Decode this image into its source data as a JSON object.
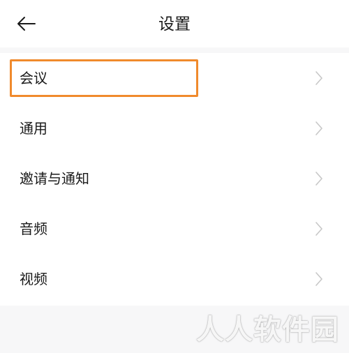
{
  "header": {
    "title": "设置",
    "back_icon": "back-arrow-icon"
  },
  "menu": {
    "items": [
      {
        "label": "会议",
        "highlighted": true
      },
      {
        "label": "通用"
      },
      {
        "label": "邀请与通知"
      },
      {
        "label": "音频"
      },
      {
        "label": "视频"
      }
    ],
    "chevron_icon": "chevron-right-icon"
  },
  "colors": {
    "highlight_border": "#f08a2c",
    "background": "#f7f7f8",
    "surface": "#ffffff",
    "chevron": "#c7c7c7"
  },
  "watermark": {
    "text": "人人软件园"
  }
}
